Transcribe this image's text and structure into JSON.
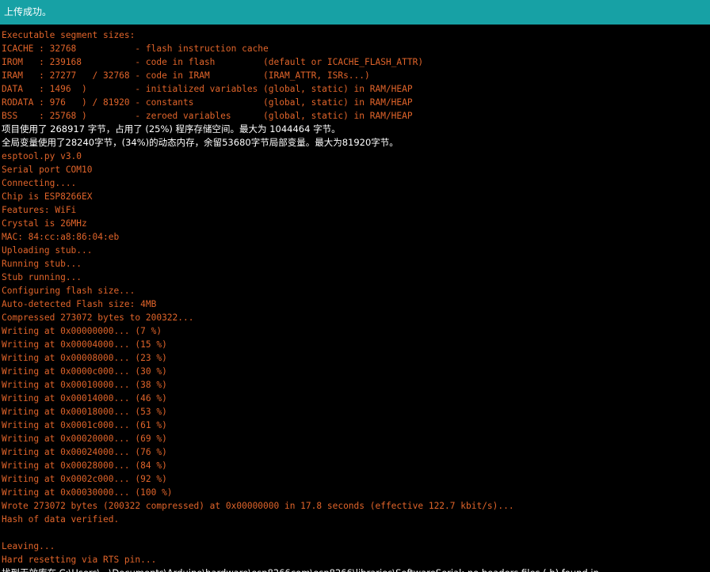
{
  "status_bar": {
    "message": "上传成功。"
  },
  "colors": {
    "status_bar_bg": "#17a1a5",
    "console_bg": "#000000",
    "error_text": "#e0642a",
    "output_text": "#ffffff"
  },
  "console": {
    "lines": [
      {
        "text": "Executable segment sizes:",
        "kind": "err"
      },
      {
        "text": "ICACHE : 32768           - flash instruction cache",
        "kind": "err"
      },
      {
        "text": "IROM   : 239168          - code in flash         (default or ICACHE_FLASH_ATTR)",
        "kind": "err"
      },
      {
        "text": "IRAM   : 27277   / 32768 - code in IRAM          (IRAM_ATTR, ISRs...)",
        "kind": "err"
      },
      {
        "text": "DATA   : 1496  )         - initialized variables (global, static) in RAM/HEAP",
        "kind": "err"
      },
      {
        "text": "RODATA : 976   ) / 81920 - constants             (global, static) in RAM/HEAP",
        "kind": "err"
      },
      {
        "text": "BSS    : 25768 )         - zeroed variables      (global, static) in RAM/HEAP",
        "kind": "err"
      },
      {
        "text": "项目使用了 268917 字节，占用了 (25%) 程序存储空间。最大为 1044464 字节。",
        "kind": "out"
      },
      {
        "text": "全局变量使用了28240字节，(34%)的动态内存，余留53680字节局部变量。最大为81920字节。",
        "kind": "out"
      },
      {
        "text": "esptool.py v3.0",
        "kind": "err"
      },
      {
        "text": "Serial port COM10",
        "kind": "err"
      },
      {
        "text": "Connecting....",
        "kind": "err"
      },
      {
        "text": "Chip is ESP8266EX",
        "kind": "err"
      },
      {
        "text": "Features: WiFi",
        "kind": "err"
      },
      {
        "text": "Crystal is 26MHz",
        "kind": "err"
      },
      {
        "text": "MAC: 84:cc:a8:86:04:eb",
        "kind": "err"
      },
      {
        "text": "Uploading stub...",
        "kind": "err"
      },
      {
        "text": "Running stub...",
        "kind": "err"
      },
      {
        "text": "Stub running...",
        "kind": "err"
      },
      {
        "text": "Configuring flash size...",
        "kind": "err"
      },
      {
        "text": "Auto-detected Flash size: 4MB",
        "kind": "err"
      },
      {
        "text": "Compressed 273072 bytes to 200322...",
        "kind": "err"
      },
      {
        "text": "Writing at 0x00000000... (7 %)",
        "kind": "err"
      },
      {
        "text": "Writing at 0x00004000... (15 %)",
        "kind": "err"
      },
      {
        "text": "Writing at 0x00008000... (23 %)",
        "kind": "err"
      },
      {
        "text": "Writing at 0x0000c000... (30 %)",
        "kind": "err"
      },
      {
        "text": "Writing at 0x00010000... (38 %)",
        "kind": "err"
      },
      {
        "text": "Writing at 0x00014000... (46 %)",
        "kind": "err"
      },
      {
        "text": "Writing at 0x00018000... (53 %)",
        "kind": "err"
      },
      {
        "text": "Writing at 0x0001c000... (61 %)",
        "kind": "err"
      },
      {
        "text": "Writing at 0x00020000... (69 %)",
        "kind": "err"
      },
      {
        "text": "Writing at 0x00024000... (76 %)",
        "kind": "err"
      },
      {
        "text": "Writing at 0x00028000... (84 %)",
        "kind": "err"
      },
      {
        "text": "Writing at 0x0002c000... (92 %)",
        "kind": "err"
      },
      {
        "text": "Writing at 0x00030000... (100 %)",
        "kind": "err"
      },
      {
        "text": "Wrote 273072 bytes (200322 compressed) at 0x00000000 in 17.8 seconds (effective 122.7 kbit/s)...",
        "kind": "err"
      },
      {
        "text": "Hash of data verified.",
        "kind": "err"
      },
      {
        "text": "",
        "kind": "err"
      },
      {
        "text": "Leaving...",
        "kind": "err"
      },
      {
        "text": "Hard resetting via RTS pin...",
        "kind": "err"
      },
      {
        "text": "找到无效库在 C:\\Users\\...\\Documents\\Arduino\\hardware\\esp8266com\\esp8266\\libraries\\SoftwareSerial: no headers files (.h) found in",
        "kind": "out"
      }
    ]
  }
}
